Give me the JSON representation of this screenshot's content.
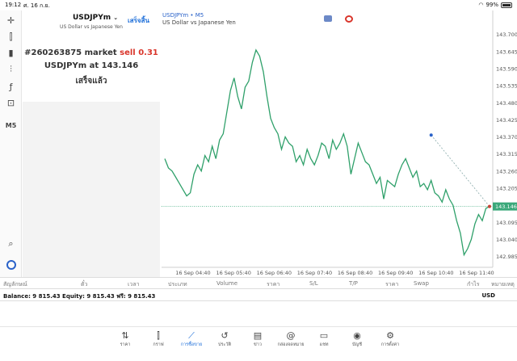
{
  "status": {
    "time": "19:12",
    "date": "ศ. 16 ก.ย.",
    "battery": "99%"
  },
  "toolbar": {
    "items": [
      {
        "name": "crosshair-icon",
        "glyph": "✛"
      },
      {
        "name": "candles-icon",
        "glyph": "⫿"
      },
      {
        "name": "bar-chart-icon",
        "glyph": "▮"
      },
      {
        "name": "indicators-icon",
        "glyph": "⫶"
      },
      {
        "name": "function-icon",
        "glyph": "ƒ"
      },
      {
        "name": "objects-icon",
        "glyph": "⊡"
      }
    ],
    "timeframe": "M5"
  },
  "order_panel": {
    "symbol": "USDJPYm",
    "description": "US Dollar vs Japanese Yen",
    "done_label": "เสร็จสิ้น",
    "order_number": "#260263875",
    "order_type": "market",
    "side_label": "sell 0.31",
    "executed": "USDJPYm at",
    "price": "143.146",
    "status": "เสร็จแล้ว"
  },
  "chart_header": {
    "symbol_line": "USDJPYm • M5",
    "description": "US Dollar vs Japanese Yen"
  },
  "chart_data": {
    "type": "line",
    "price_color": "#2fa06a",
    "ylim": [
      142.95,
      143.72
    ],
    "y_ticks": [
      "143.700",
      "143.645",
      "143.590",
      "143.535",
      "143.480",
      "143.425",
      "143.370",
      "143.315",
      "143.260",
      "143.205",
      "143.150",
      "143.095",
      "143.040",
      "142.985"
    ],
    "x_ticks": [
      "16 Sep 04:40",
      "16 Sep 05:40",
      "16 Sep 06:40",
      "16 Sep 07:40",
      "16 Sep 08:40",
      "16 Sep 09:40",
      "16 Sep 10:40",
      "16 Sep 11:40"
    ],
    "current_price": "143.146",
    "values": [
      143.3,
      143.27,
      143.26,
      143.24,
      143.22,
      143.2,
      143.18,
      143.19,
      143.25,
      143.28,
      143.26,
      143.31,
      143.29,
      143.34,
      143.3,
      143.36,
      143.38,
      143.45,
      143.52,
      143.56,
      143.5,
      143.46,
      143.53,
      143.55,
      143.61,
      143.65,
      143.63,
      143.58,
      143.5,
      143.43,
      143.4,
      143.38,
      143.33,
      143.37,
      143.35,
      143.34,
      143.29,
      143.31,
      143.28,
      143.33,
      143.3,
      143.28,
      143.31,
      143.35,
      143.34,
      143.3,
      143.36,
      143.33,
      143.35,
      143.38,
      143.34,
      143.25,
      143.3,
      143.35,
      143.32,
      143.29,
      143.28,
      143.25,
      143.22,
      143.24,
      143.17,
      143.23,
      143.22,
      143.21,
      143.25,
      143.28,
      143.3,
      143.27,
      143.24,
      143.26,
      143.21,
      143.22,
      143.2,
      143.23,
      143.19,
      143.18,
      143.16,
      143.2,
      143.17,
      143.15,
      143.1,
      143.06,
      142.99,
      143.01,
      143.04,
      143.09,
      143.12,
      143.1,
      143.14,
      143.146
    ],
    "trade_line": {
      "open_price": 143.376,
      "close_price": 143.146
    }
  },
  "table_header": {
    "columns": [
      "สัญลักษณ์",
      "ตั๋ว",
      "เวลา",
      "ประเภท",
      "Volume",
      "ราคา",
      "S/L",
      "T/P",
      "ราคา",
      "Swap",
      "กำไร",
      "หมายเหตุ"
    ]
  },
  "balance": {
    "text": "Balance: 9 815.43 Equity: 9 815.43 ฟรี: 9 815.43",
    "currency": "USD"
  },
  "tabs": [
    {
      "label": "ราคา",
      "icon": "quotes-icon",
      "glyph": "⇅"
    },
    {
      "label": "กราฟ",
      "icon": "chart-icon",
      "glyph": "⫿"
    },
    {
      "label": "การซื้อขาย",
      "icon": "trade-icon",
      "glyph": "⟋",
      "active": true
    },
    {
      "label": "ประวัติ",
      "icon": "history-icon",
      "glyph": "↺"
    },
    {
      "label": "ข่าว",
      "icon": "news-icon",
      "glyph": "▤"
    },
    {
      "label": "กล่องจดหมาย",
      "icon": "mailbox-icon",
      "glyph": "@"
    },
    {
      "label": "แชท",
      "icon": "chat-icon",
      "glyph": "▭"
    },
    {
      "label": "บัญชี",
      "icon": "account-icon",
      "glyph": "◉"
    },
    {
      "label": "การตั้งค่า",
      "icon": "settings-icon",
      "glyph": "⚙"
    }
  ]
}
